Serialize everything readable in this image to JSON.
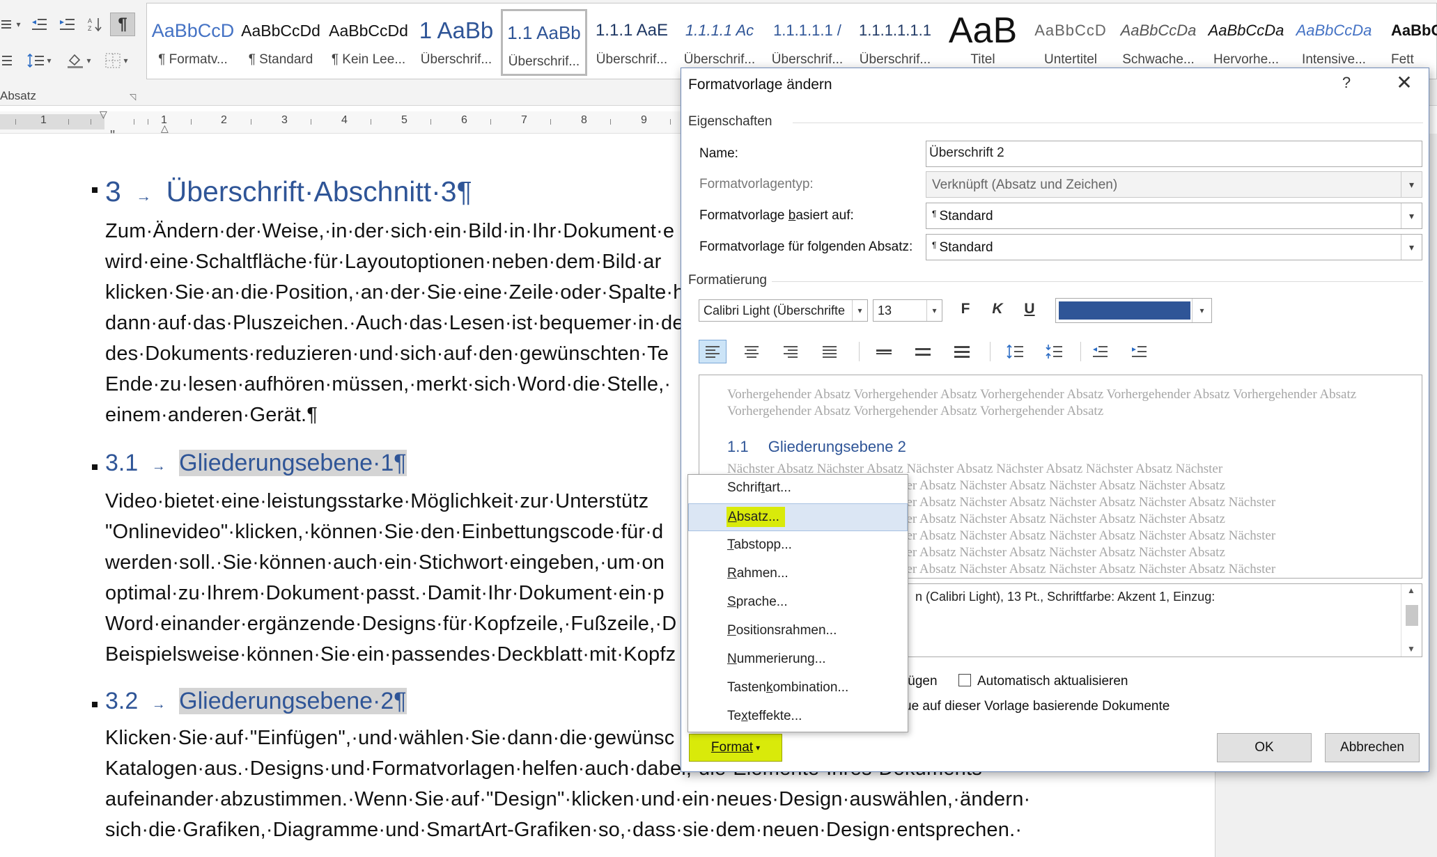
{
  "ribbon": {
    "group_label": "Absatz",
    "styles": [
      {
        "preview": "AaBbCcD",
        "name": "¶ Formatv..."
      },
      {
        "preview": "AaBbCcDd",
        "name": "¶ Standard"
      },
      {
        "preview": "AaBbCcDd",
        "name": "¶ Kein Lee..."
      },
      {
        "preview": "1  AaBb",
        "name": "Überschrif..."
      },
      {
        "preview": "1.1  AaBb",
        "name": "Überschrif..."
      },
      {
        "preview": "1.1.1  AaE",
        "name": "Überschrif..."
      },
      {
        "preview": "1.1.1.1  Ac",
        "name": "Überschrif..."
      },
      {
        "preview": "1.1.1.1.1  /",
        "name": "Überschrif..."
      },
      {
        "preview": "1.1.1.1.1.1",
        "name": "Überschrif..."
      },
      {
        "preview": "AaB",
        "name": "Titel"
      },
      {
        "preview": "AaBbCcD",
        "name": "Untertitel"
      },
      {
        "preview": "AaBbCcDa",
        "name": "Schwache..."
      },
      {
        "preview": "AaBbCcDa",
        "name": "Hervorhe..."
      },
      {
        "preview": "AaBbCcDa",
        "name": "Intensive..."
      },
      {
        "preview": "AaBbCc",
        "name": "Fett"
      }
    ]
  },
  "ruler": {
    "numbers": [
      "1",
      "1",
      "2",
      "3",
      "4",
      "5",
      "6",
      "7",
      "8",
      "9"
    ]
  },
  "document": {
    "top_mark": "\"",
    "h1": {
      "num": "3",
      "text": "Überschrift·Abschnitt·3¶"
    },
    "p1": [
      "Zum·Ändern·der·Weise,·in·der·sich·ein·Bild·in·Ihr·Dokument·e",
      "wird·eine·Schaltfläche·für·Layoutoptionen·neben·dem·Bild·ar",
      "klicken·Sie·an·die·Position,·an·der·Sie·eine·Zeile·oder·Spalte·h",
      "dann·auf·das·Pluszeichen.·Auch·das·Lesen·ist·bequemer·in·de",
      "des·Dokuments·reduzieren·und·sich·auf·den·gewünschten·Te",
      "Ende·zu·lesen·aufhören·müssen,·merkt·sich·Word·die·Stelle,·",
      "einem·anderen·Gerät.¶"
    ],
    "h2a": {
      "num": "3.1",
      "text": "Gliederungsebene·1¶"
    },
    "p2": [
      "Video·bietet·eine·leistungsstarke·Möglichkeit·zur·Unterstütz",
      "\"Onlinevideo\"·klicken,·können·Sie·den·Einbettungscode·für·d",
      "werden·soll.·Sie·können·auch·ein·Stichwort·eingeben,·um·on",
      "optimal·zu·Ihrem·Dokument·passt.·Damit·Ihr·Dokument·ein·p",
      "Word·einander·ergänzende·Designs·für·Kopfzeile,·Fußzeile,·D",
      "Beispielsweise·können·Sie·ein·passendes·Deckblatt·mit·Kopfz"
    ],
    "h2b": {
      "num": "3.2",
      "text": "Gliederungsebene·2¶"
    },
    "p3": [
      "Klicken·Sie·auf·\"Einfügen\",·und·wählen·Sie·dann·die·gewünsc",
      "Katalogen·aus.·Designs·und·Formatvorlagen·helfen·auch·dabei,·die·Elemente·Ihres·Dokuments·",
      "aufeinander·abzustimmen.·Wenn·Sie·auf·\"Design\"·klicken·und·ein·neues·Design·auswählen,·ändern·",
      "sich·die·Grafiken,·Diagramme·und·SmartArt-Grafiken·so,·dass·sie·dem·neuen·Design·entsprechen.·"
    ]
  },
  "dialog": {
    "title": "Formatvorlage ändern",
    "help": "?",
    "close": "✕",
    "properties_label": "Eigenschaften",
    "name_label": "Name:",
    "name_value": "Überschrift 2",
    "type_label": "Formatvorlagentyp:",
    "type_value": "Verknüpft (Absatz und Zeichen)",
    "based_on_label_pre": "Formatvorlage ",
    "based_on_label_key": "b",
    "based_on_label_post": "asiert auf:",
    "based_on_value": "Standard",
    "following_label": "Formatvorlage für folgenden Absatz:",
    "following_value": "Standard",
    "formatting_label": "Formatierung",
    "font_value": "Calibri Light (Überschrifte",
    "size_value": "13",
    "bold_label": "F",
    "italic_label": "K",
    "underline_label": "U",
    "font_color": "#2f5597",
    "preview_prev": "Vorhergehender Absatz Vorhergehender Absatz Vorhergehender Absatz Vorhergehender Absatz Vorhergehender Absatz Vorhergehender Absatz Vorhergehender Absatz Vorhergehender Absatz",
    "preview_heading_num": "1.1",
    "preview_heading_text": "Gliederungsebene 2",
    "preview_next": [
      "Nächster Absatz Nächster Absatz Nächster Absatz Nächster Absatz Nächster Absatz Nächster",
      "er Absatz Nächster Absatz Nächster Absatz Nächster Absatz Nächster Absatz Nächster Absatz",
      "er Absatz Nächster Absatz Nächster Absatz Nächster Absatz Nächster Absatz Nächster Absatz Nächster",
      "er Absatz Nächster Absatz Nächster Absatz Nächster Absatz Nächster Absatz Nächster Absatz",
      "er Absatz Nächster Absatz Nächster Absatz Nächster Absatz Nächster Absatz Nächster Absatz Nächster",
      "er Absatz Nächster Absatz Nächster Absatz Nächster Absatz Nächster Absatz Nächster Absatz",
      "er Absatz Nächster Absatz Nächster Absatz Nächster Absatz Nächster Absatz Nächster Absatz Nächster"
    ],
    "description": "n (Calibri Light), 13 Pt., Schriftfarbe: Akzent 1, Einzug:",
    "add_to_gallery_fragment": "fügen",
    "auto_update_label": "Automatisch aktualisieren",
    "new_docs_fragment": "ue auf dieser Vorlage basierende Dokumente",
    "ok_label": "OK",
    "cancel_label": "Abbrechen",
    "format_button_label": "Format",
    "format_button_arrow": "▾"
  },
  "format_menu": {
    "items": [
      {
        "pre": "Schrif",
        "key": "t",
        "post": "art..."
      },
      {
        "pre": "",
        "key": "A",
        "post": "bsatz..."
      },
      {
        "pre": "",
        "key": "T",
        "post": "abstopp..."
      },
      {
        "pre": "",
        "key": "R",
        "post": "ahmen..."
      },
      {
        "pre": "",
        "key": "S",
        "post": "prache..."
      },
      {
        "pre": "",
        "key": "P",
        "post": "ositionsrahmen..."
      },
      {
        "pre": "",
        "key": "N",
        "post": "ummerierung..."
      },
      {
        "pre": "Tasten",
        "key": "k",
        "post": "ombination..."
      },
      {
        "pre": "Te",
        "key": "x",
        "post": "teffekte..."
      }
    ]
  },
  "colors": {
    "heading_blue": "#2f5597",
    "highlight_yellow": "#d9ea0a",
    "menu_hover": "#dbe6f4"
  }
}
